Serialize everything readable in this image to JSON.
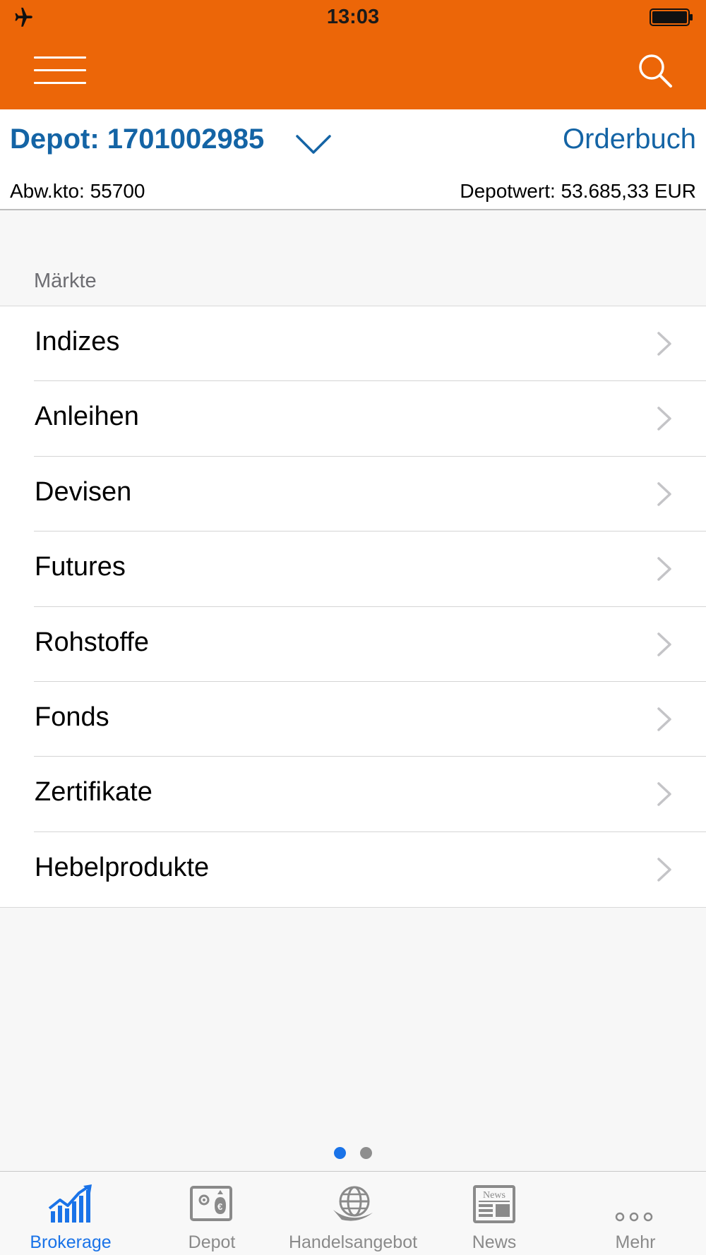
{
  "status_bar": {
    "time": "13:03"
  },
  "header": {
    "menu_icon": "hamburger-icon",
    "search_icon": "search-icon"
  },
  "depot": {
    "title": "Depot: 1701002985",
    "orderbuch_label": "Orderbuch",
    "abw_kto": "Abw.kto: 55700",
    "depotwert": "Depotwert: 53.685,33 EUR"
  },
  "markets": {
    "section_label": "Märkte",
    "items": [
      {
        "label": "Indizes"
      },
      {
        "label": "Anleihen"
      },
      {
        "label": "Devisen"
      },
      {
        "label": "Futures"
      },
      {
        "label": "Rohstoffe"
      },
      {
        "label": "Fonds"
      },
      {
        "label": "Zertifikate"
      },
      {
        "label": "Hebelprodukte"
      }
    ]
  },
  "page_indicator": {
    "pages": 2,
    "current": 1
  },
  "tabs": [
    {
      "label": "Brokerage",
      "icon": "brokerage-chart-icon",
      "active": true
    },
    {
      "label": "Depot",
      "icon": "depot-icon",
      "active": false
    },
    {
      "label": "Handelsangebot",
      "icon": "globe-icon",
      "active": false
    },
    {
      "label": "News",
      "icon": "news-icon",
      "active": false
    },
    {
      "label": "Mehr",
      "icon": "more-dots-icon",
      "active": false
    }
  ],
  "colors": {
    "brand_orange": "#ec6608",
    "link_blue": "#1464a5",
    "active_tab_blue": "#1a73e8",
    "inactive_gray": "#8a8a8a"
  }
}
